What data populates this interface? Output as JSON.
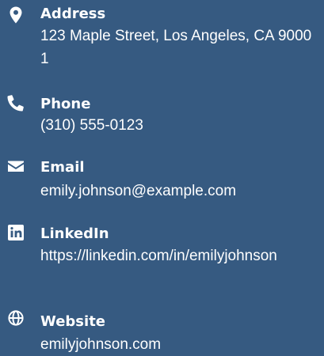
{
  "contacts": {
    "address": {
      "icon": "map-marker-icon",
      "label": "Address",
      "value": "123 Maple Street, Los Angeles, CA 90001"
    },
    "phone": {
      "icon": "phone-icon",
      "label": "Phone",
      "value": "(310) 555-0123"
    },
    "email": {
      "icon": "envelope-icon",
      "label": "Email",
      "value": "emily.johnson@example.com"
    },
    "linkedin": {
      "icon": "linkedin-icon",
      "label": "LinkedIn",
      "value": "https://linkedin.com/in/emilyjohnson"
    },
    "website": {
      "icon": "globe-icon",
      "label": "Website",
      "value": "emilyjohnson.com"
    }
  },
  "colors": {
    "background": "#365a81",
    "text": "#ffffff"
  }
}
